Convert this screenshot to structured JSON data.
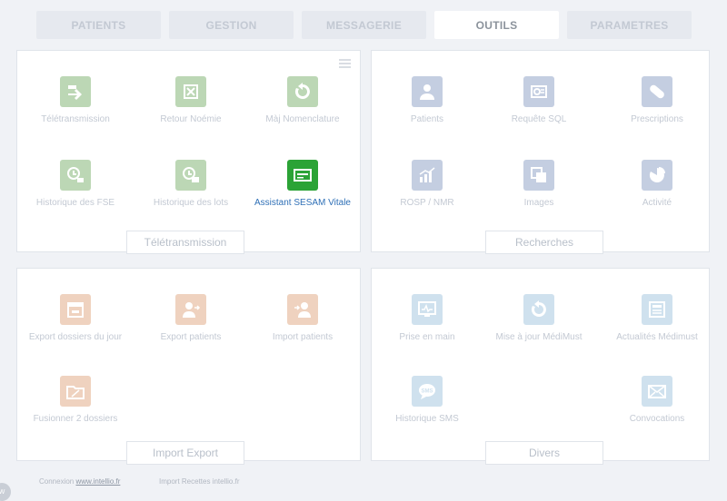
{
  "tabs": [
    "PATIENTS",
    "GESTION",
    "MESSAGERIE",
    "OUTILS",
    "PARAMETRES"
  ],
  "active_tab": "OUTILS",
  "teletransmission": {
    "title": "Télétransmission",
    "items": [
      "Télétransmission",
      "Retour Noémie",
      "Màj Nomenclature",
      "Historique des FSE",
      "Historique des lots",
      "Assistant SESAM Vitale"
    ]
  },
  "recherches": {
    "title": "Recherches",
    "items": [
      "Patients",
      "Requête SQL",
      "Prescriptions",
      "ROSP / NMR",
      "Images",
      "Activité"
    ]
  },
  "import_export": {
    "title": "Import Export",
    "items": [
      "Export dossiers du jour",
      "Export patients",
      "Import patients",
      "Fusionner 2 dossiers"
    ]
  },
  "divers": {
    "title": "Divers",
    "items": [
      "Prise en main",
      "Mise à jour MédiMust",
      "Actualités Médimust",
      "Historique SMS",
      "Convocations"
    ]
  },
  "footer": {
    "connexion_label": "Connexion",
    "connexion_link": "www.intellio.fr",
    "import_recettes": "Import Recettes intellio.fr",
    "badge": "W"
  },
  "colors": {
    "green_icon": "#bcd7b5",
    "blue_icon": "#c4cee1",
    "orange_icon": "#efd2bf",
    "lightblue_icon": "#cfe1ee",
    "highlight_icon": "#2ba336",
    "highlight_text": "#2e6fb6"
  }
}
